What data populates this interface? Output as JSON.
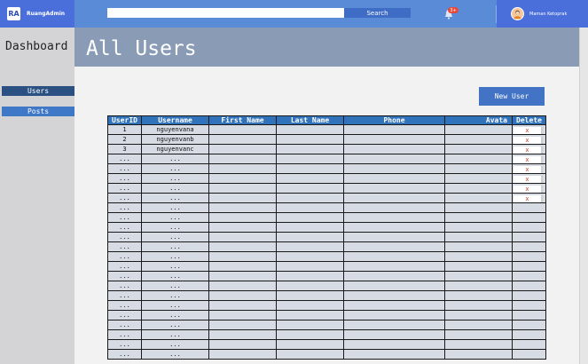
{
  "brand": {
    "logo": "RA",
    "name": "RuangAdmin"
  },
  "search": {
    "placeholder": "",
    "button_label": "Search"
  },
  "notifications": {
    "icon": "bell-icon",
    "badge": "3+"
  },
  "user": {
    "name": "Maman Ketoprak",
    "avatar_icon": "avatar-icon"
  },
  "sidebar": {
    "title": "Dashboard",
    "items": [
      {
        "label": "Users"
      },
      {
        "label": "Posts"
      }
    ]
  },
  "page": {
    "title": "All Users",
    "new_user_label": "New User"
  },
  "table": {
    "columns": [
      "UserID",
      "Username",
      "First Name",
      "Last Name",
      "Phone",
      "Avata",
      "Delete"
    ],
    "rows": [
      {
        "id": "1",
        "username": "nguyenvana",
        "first": "",
        "last": "",
        "phone": "",
        "avatar": "",
        "delete": "x"
      },
      {
        "id": "2",
        "username": "nguyenvanb",
        "first": "",
        "last": "",
        "phone": "",
        "avatar": "",
        "delete": "x"
      },
      {
        "id": "3",
        "username": "nguyenvanc",
        "first": "",
        "last": "",
        "phone": "",
        "avatar": "",
        "delete": "x"
      },
      {
        "id": "...",
        "username": "...",
        "first": "",
        "last": "",
        "phone": "",
        "avatar": "",
        "delete": "x"
      },
      {
        "id": "...",
        "username": "...",
        "first": "",
        "last": "",
        "phone": "",
        "avatar": "",
        "delete": "x"
      },
      {
        "id": "...",
        "username": "...",
        "first": "",
        "last": "",
        "phone": "",
        "avatar": "",
        "delete": "x"
      },
      {
        "id": "...",
        "username": "...",
        "first": "",
        "last": "",
        "phone": "",
        "avatar": "",
        "delete": "x"
      },
      {
        "id": "...",
        "username": "...",
        "first": "",
        "last": "",
        "phone": "",
        "avatar": "",
        "delete": "x"
      },
      {
        "id": "...",
        "username": "...",
        "first": "",
        "last": "",
        "phone": "",
        "avatar": "",
        "delete": ""
      },
      {
        "id": "...",
        "username": "...",
        "first": "",
        "last": "",
        "phone": "",
        "avatar": "",
        "delete": ""
      },
      {
        "id": "...",
        "username": "...",
        "first": "",
        "last": "",
        "phone": "",
        "avatar": "",
        "delete": ""
      },
      {
        "id": "...",
        "username": "...",
        "first": "",
        "last": "",
        "phone": "",
        "avatar": "",
        "delete": ""
      },
      {
        "id": "...",
        "username": "...",
        "first": "",
        "last": "",
        "phone": "",
        "avatar": "",
        "delete": ""
      },
      {
        "id": "...",
        "username": "...",
        "first": "",
        "last": "",
        "phone": "",
        "avatar": "",
        "delete": ""
      },
      {
        "id": "...",
        "username": "...",
        "first": "",
        "last": "",
        "phone": "",
        "avatar": "",
        "delete": ""
      },
      {
        "id": "...",
        "username": "...",
        "first": "",
        "last": "",
        "phone": "",
        "avatar": "",
        "delete": ""
      },
      {
        "id": "...",
        "username": "...",
        "first": "",
        "last": "",
        "phone": "",
        "avatar": "",
        "delete": ""
      },
      {
        "id": "...",
        "username": "...",
        "first": "",
        "last": "",
        "phone": "",
        "avatar": "",
        "delete": ""
      },
      {
        "id": "...",
        "username": "...",
        "first": "",
        "last": "",
        "phone": "",
        "avatar": "",
        "delete": ""
      },
      {
        "id": "...",
        "username": "...",
        "first": "",
        "last": "",
        "phone": "",
        "avatar": "",
        "delete": ""
      },
      {
        "id": "...",
        "username": "...",
        "first": "",
        "last": "",
        "phone": "",
        "avatar": "",
        "delete": ""
      },
      {
        "id": "...",
        "username": "...",
        "first": "",
        "last": "",
        "phone": "",
        "avatar": "",
        "delete": ""
      },
      {
        "id": "...",
        "username": "...",
        "first": "",
        "last": "",
        "phone": "",
        "avatar": "",
        "delete": ""
      },
      {
        "id": "...",
        "username": "...",
        "first": "",
        "last": "",
        "phone": "",
        "avatar": "",
        "delete": ""
      }
    ]
  },
  "colors": {
    "topbar": "#5a8bd6",
    "brand_bg": "#4a6fdb",
    "header_band": "#8a9bb6",
    "accent_button": "#4273c4",
    "table_header": "#3173bb",
    "delete_x": "#c0392b"
  }
}
